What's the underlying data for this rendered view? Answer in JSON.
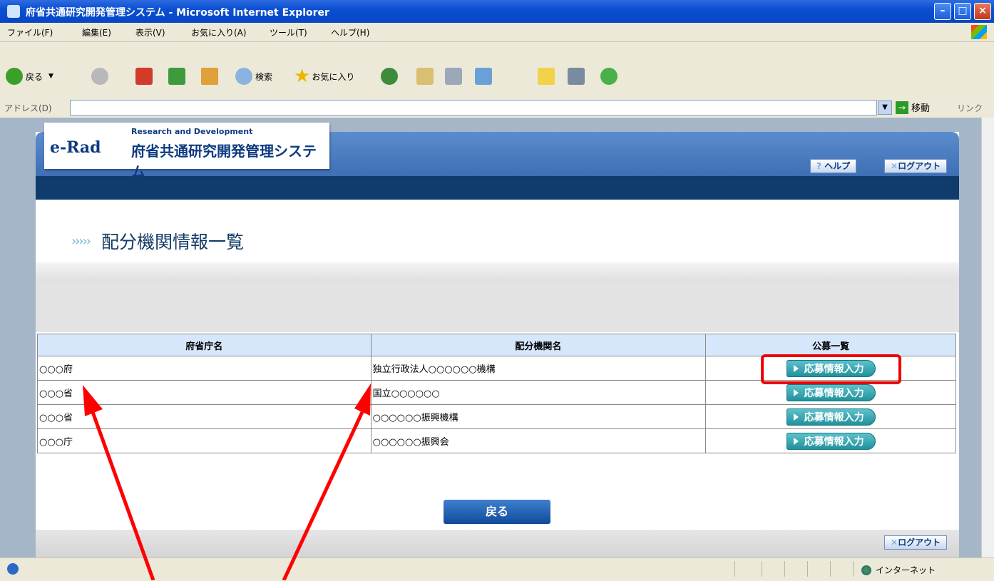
{
  "window": {
    "title": "府省共通研究開発管理システム - Microsoft Internet Explorer"
  },
  "menu": [
    "ファイル(F)",
    "編集(E)",
    "表示(V)",
    "お気に入り(A)",
    "ツール(T)",
    "ヘルプ(H)"
  ],
  "toolbar": {
    "back": "戻る",
    "search": "検索",
    "favorites": "お気に入り"
  },
  "address": {
    "label": "アドレス(D)",
    "value": "",
    "go": "移動",
    "links": "リンク"
  },
  "app": {
    "brand": "e-Rad",
    "tagline": "Research and Development",
    "system_name": "府省共通研究開発管理システム",
    "help": "ヘルプ",
    "logout": "ログアウト"
  },
  "page": {
    "heading": "配分機関情報一覧",
    "back_button": "戻る",
    "footer_logout": "ログアウト"
  },
  "table": {
    "headers": [
      "府省庁名",
      "配分機関名",
      "公募一覧"
    ],
    "rows": [
      {
        "ministry": "○○○府",
        "agency": "独立行政法人○○○○○○機構",
        "action": "応募情報入力"
      },
      {
        "ministry": "○○○省",
        "agency": "国立○○○○○○",
        "action": "応募情報入力"
      },
      {
        "ministry": "○○○省",
        "agency": "○○○○○○振興機構",
        "action": "応募情報入力"
      },
      {
        "ministry": "○○○庁",
        "agency": "○○○○○○振興会",
        "action": "応募情報入力"
      }
    ]
  },
  "status": {
    "zone": "インターネット"
  },
  "colors": {
    "annotation": "#ff0000",
    "header_band": "#0f3b6d",
    "button_teal": "#1e8f9a"
  }
}
